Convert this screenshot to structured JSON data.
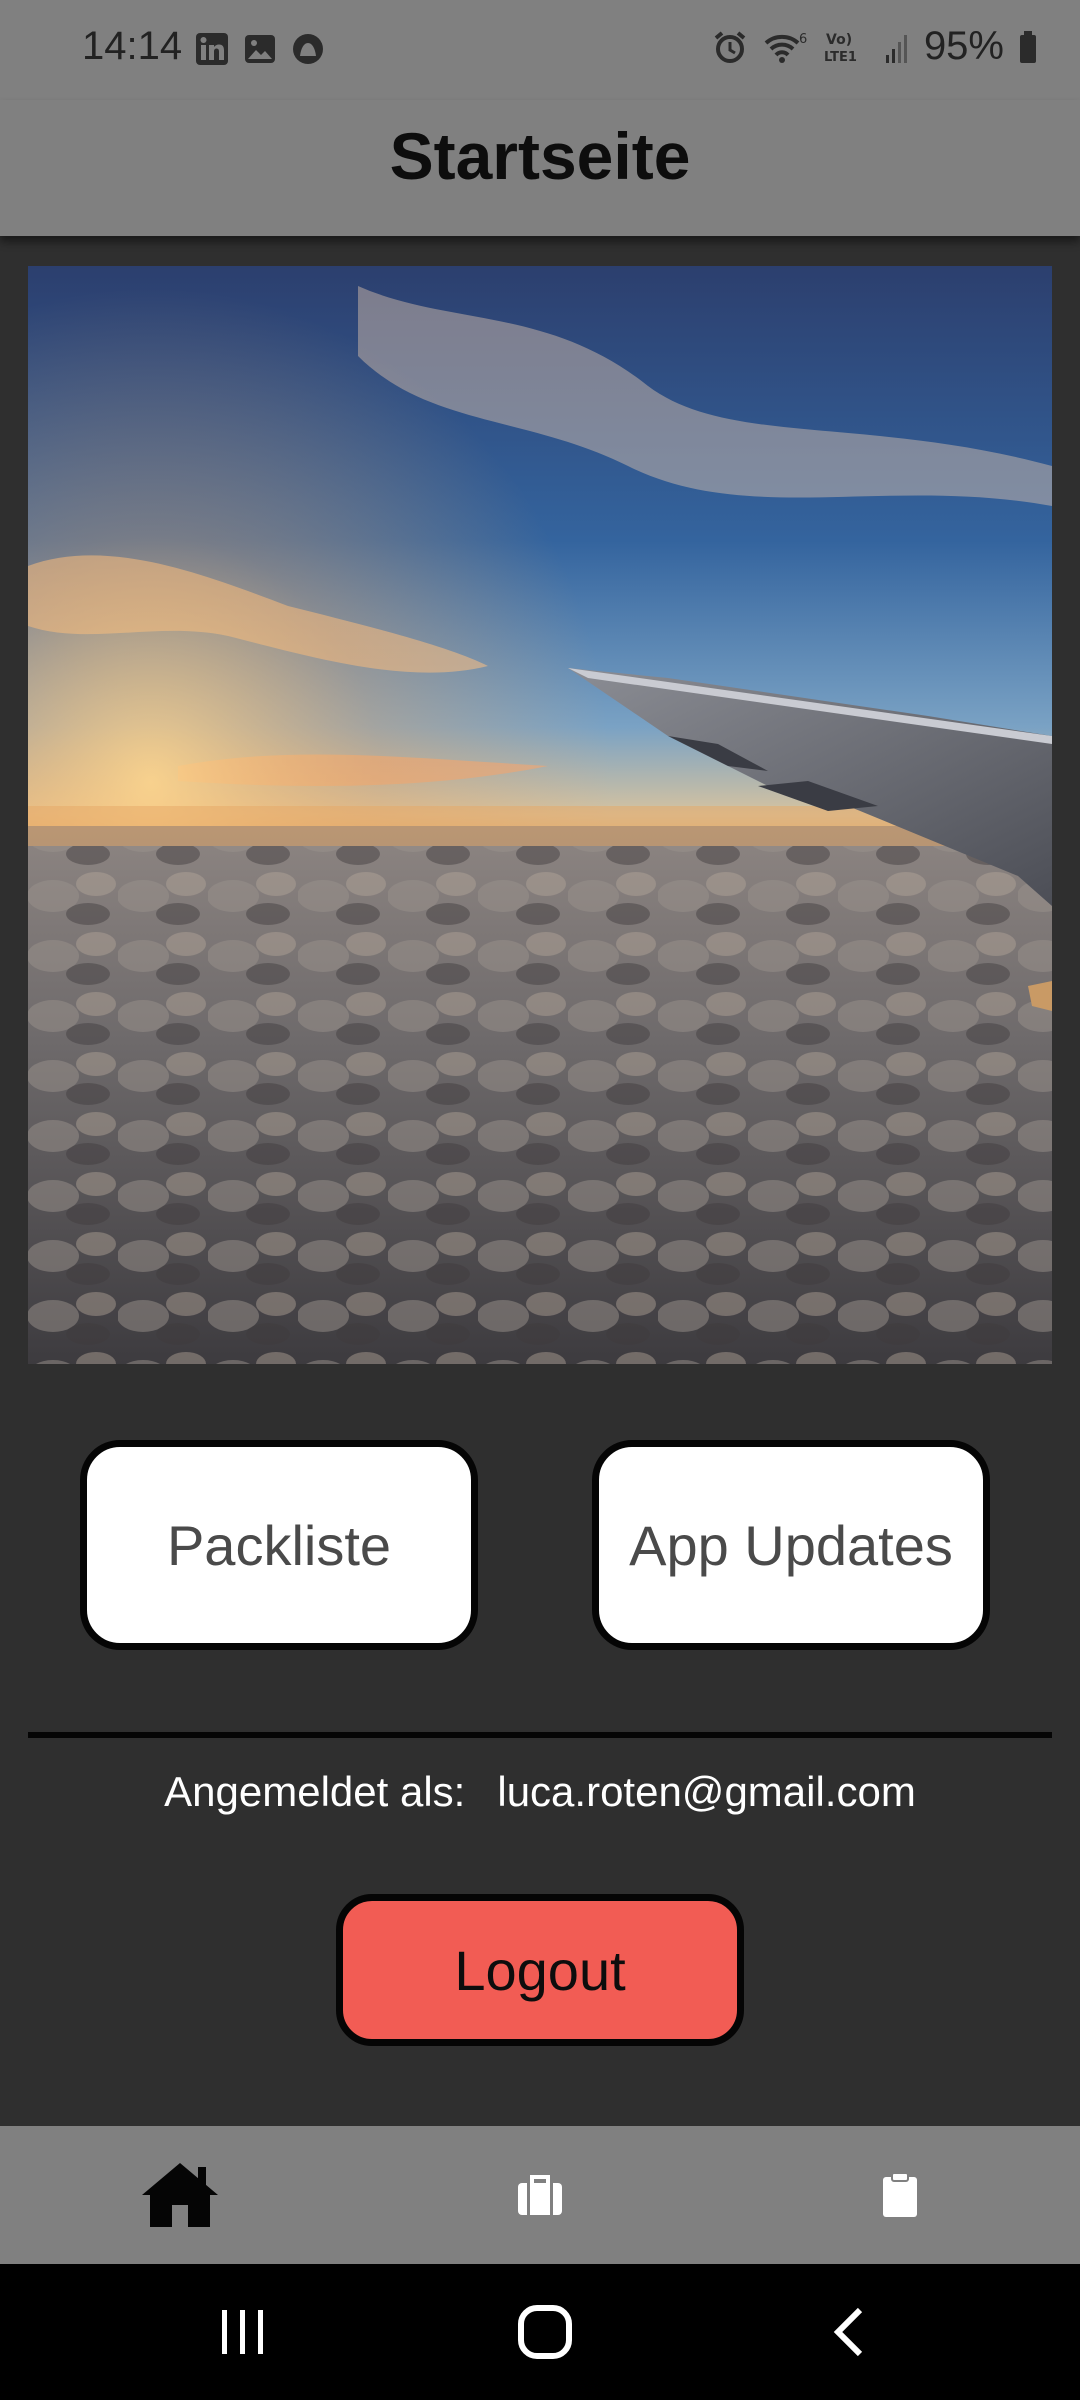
{
  "status_bar": {
    "time": "14:14",
    "left_icons": [
      "linkedin-icon",
      "gallery-icon",
      "app-notification-icon"
    ],
    "right_icons": [
      "alarm-icon",
      "wifi-6-icon",
      "volte-lte-icon",
      "signal-icon"
    ],
    "battery_text": "95%"
  },
  "header": {
    "title": "Startseite"
  },
  "hero": {
    "description_icon": "airplane-wing-above-clouds-image"
  },
  "buttons": {
    "packliste_label": "Packliste",
    "app_updates_label": "App Updates",
    "logout_label": "Logout"
  },
  "account": {
    "prefix": "Angemeldet als:",
    "email": "luca.roten@gmail.com"
  },
  "bottom_nav": {
    "items": [
      "home-icon",
      "suitcase-icon",
      "clipboard-icon"
    ],
    "active_index": 0
  },
  "system_nav": {
    "items": [
      "recents-icon",
      "home-icon",
      "back-icon"
    ]
  },
  "colors": {
    "bar_gray": "#808080",
    "background": "#2f2f2f",
    "logout_red": "#f25c54",
    "button_white": "#ffffff"
  }
}
